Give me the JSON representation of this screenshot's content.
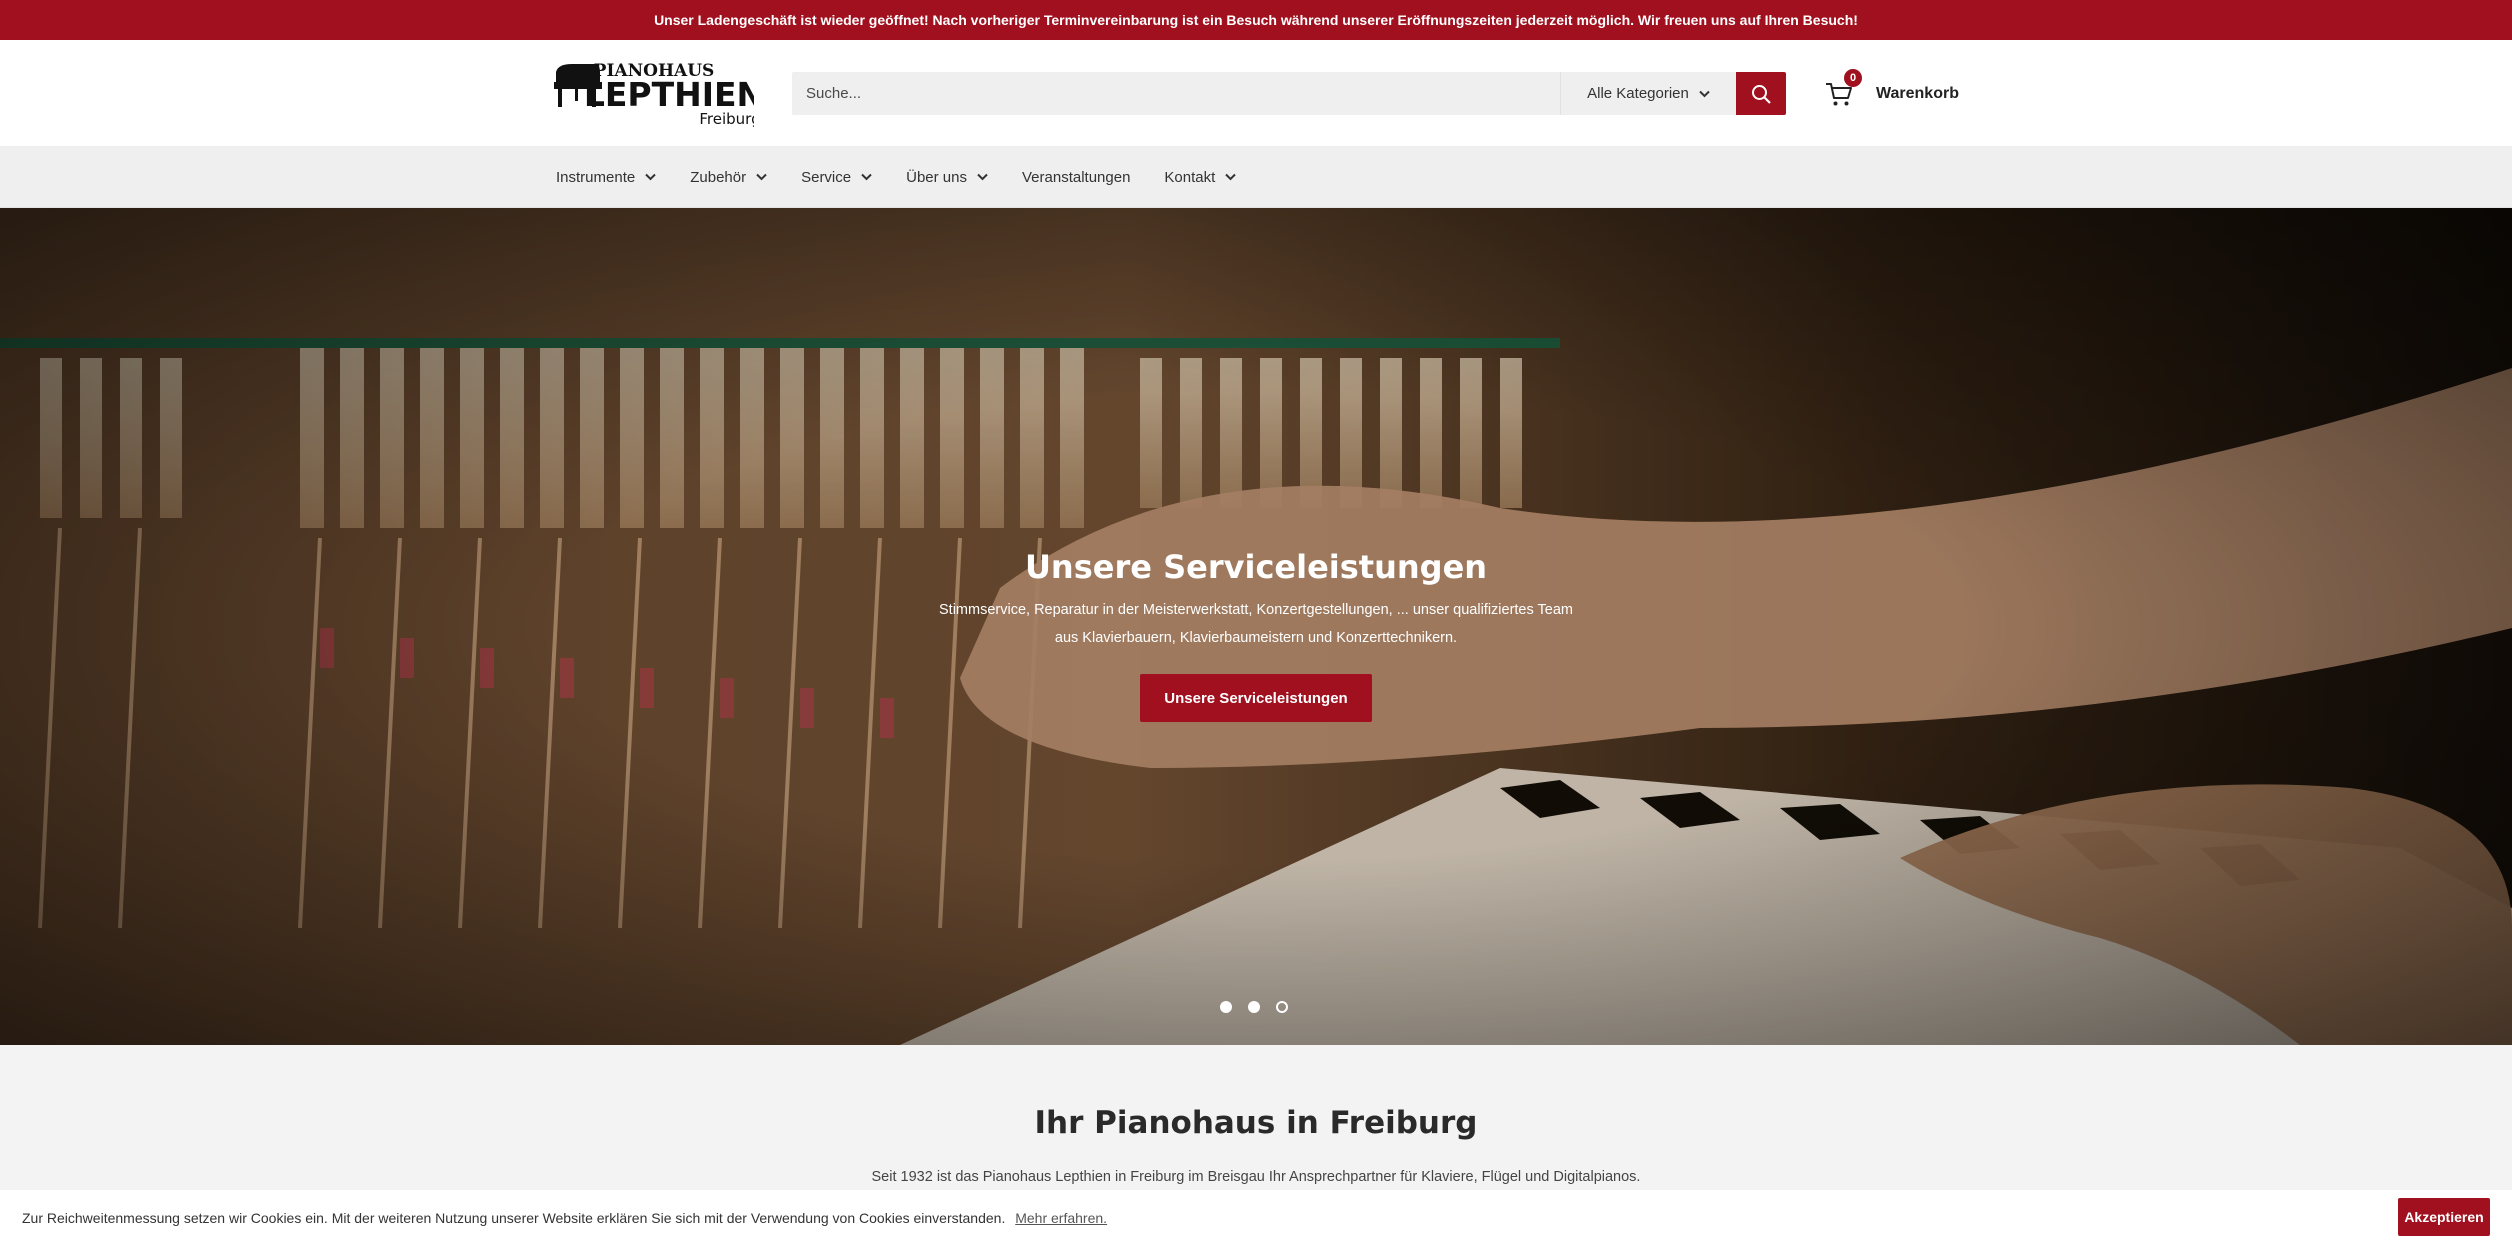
{
  "announcement": {
    "text": "Unser Ladengeschäft ist wieder geöffnet! Nach vorheriger Terminvereinbarung ist ein Besuch während unserer Eröffnungszeiten jederzeit möglich. Wir freuen uns auf Ihren Besuch!"
  },
  "logo": {
    "line1": "PIANOHAUS",
    "line2": "LEPTHIEN",
    "line3": "Freiburg"
  },
  "search": {
    "placeholder": "Suche...",
    "category_label": "Alle Kategorien",
    "icons": {
      "category": "chevron-down-icon",
      "submit": "search-icon"
    }
  },
  "cart": {
    "count": "0",
    "label": "Warenkorb",
    "icon": "cart-icon"
  },
  "nav": {
    "items": [
      {
        "label": "Instrumente",
        "has_dropdown": true
      },
      {
        "label": "Zubehör",
        "has_dropdown": true
      },
      {
        "label": "Service",
        "has_dropdown": true
      },
      {
        "label": "Über uns",
        "has_dropdown": true
      },
      {
        "label": "Veranstaltungen",
        "has_dropdown": false
      },
      {
        "label": "Kontakt",
        "has_dropdown": true
      }
    ]
  },
  "hero": {
    "title": "Unsere Serviceleistungen",
    "text_line1": "Stimmservice, Reparatur in der Meisterwerkstatt, Konzertgestellungen, ... unser qualifiziertes Team",
    "text_line2": "aus Klavierbauern, Klavierbaumeistern und Konzerttechnikern.",
    "button_label": "Unsere Serviceleistungen",
    "slides_total": 3,
    "active_slide": 3
  },
  "intro": {
    "title": "Ihr Pianohaus in Freiburg",
    "text": "Seit 1932 ist das Pianohaus Lepthien in Freiburg im Breisgau Ihr Ansprechpartner für Klaviere, Flügel und Digitalpianos."
  },
  "cookie": {
    "text": "Zur Reichweitenmessung setzen wir Cookies ein. Mit der weiteren Nutzung unserer Website erklären Sie sich mit der Verwendung von Cookies einverstanden.",
    "link": "Mehr erfahren.",
    "button": "Akzeptieren"
  },
  "colors": {
    "brand": "#a0101f",
    "nav_bg": "#efefef",
    "page_bg": "#f3f3f3"
  }
}
